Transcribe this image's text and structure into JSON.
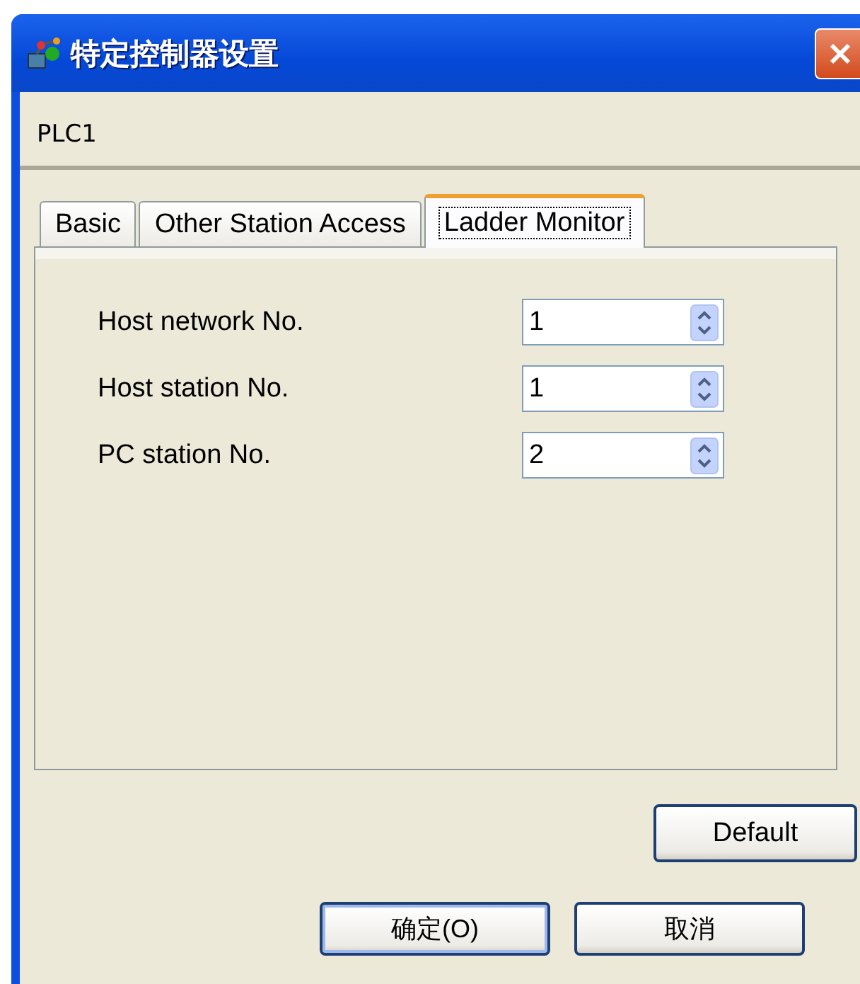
{
  "window": {
    "title": "特定控制器设置"
  },
  "device_name": "PLC1",
  "tabs": [
    {
      "label": "Basic",
      "selected": false
    },
    {
      "label": "Other Station Access",
      "selected": false
    },
    {
      "label": "Ladder Monitor",
      "selected": true
    }
  ],
  "fields": [
    {
      "label": "Host network No.",
      "value": "1"
    },
    {
      "label": "Host station No.",
      "value": "1"
    },
    {
      "label": "PC station No.",
      "value": "2"
    }
  ],
  "default_button": "Default",
  "buttons": [
    {
      "label": "确定(O)",
      "default": true
    },
    {
      "label": "取消",
      "default": false
    }
  ]
}
